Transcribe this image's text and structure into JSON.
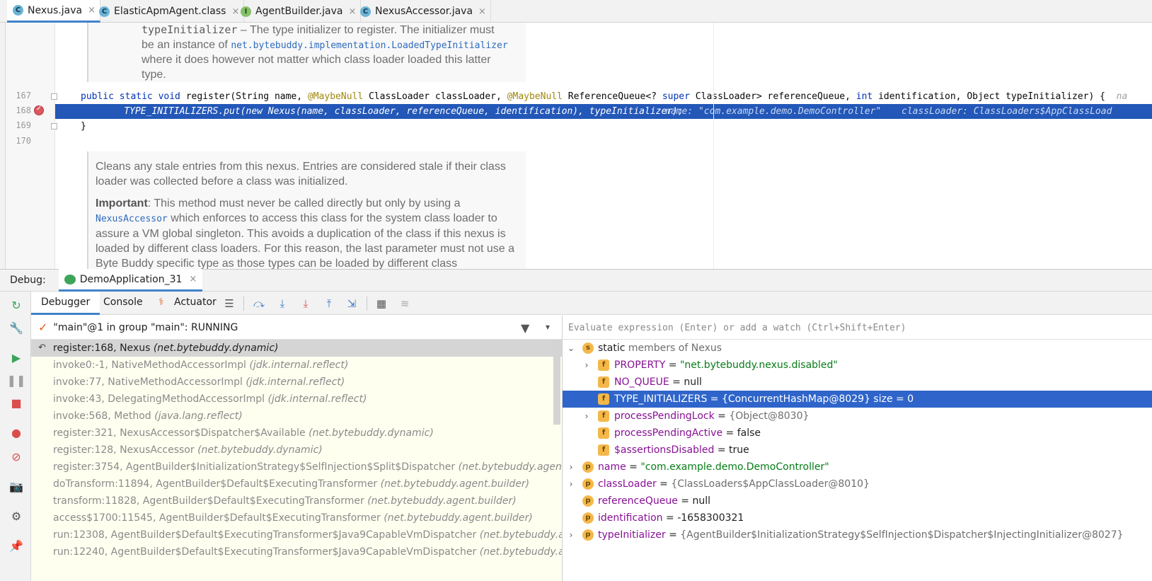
{
  "editor_tabs": [
    {
      "label": "Nexus.java",
      "icon": "class-icon",
      "active": true
    },
    {
      "label": "ElasticApmAgent.class",
      "icon": "class-icon",
      "active": false
    },
    {
      "label": "AgentBuilder.java",
      "icon": "interface-icon",
      "active": false
    },
    {
      "label": "NexusAccessor.java",
      "icon": "class-icon",
      "active": false
    }
  ],
  "tab_close": "×",
  "editor": {
    "doc_top": {
      "param_name": "typeInitializer",
      "line1_rest": " – The type initializer to register. The initializer must",
      "line2_pre": "be an instance of ",
      "line2_link": "net.bytebuddy.implementation.LoadedTypeInitializer",
      "line3": "where it does however not matter which class loader loaded this latter",
      "line4": "type."
    },
    "line_numbers": [
      "167",
      "168",
      "169",
      "170"
    ],
    "code_167": {
      "kw1": "public static void ",
      "p1": "register(String name, ",
      "ann1": "@MaybeNull ",
      "p2": "ClassLoader classLoader, ",
      "ann2": "@MaybeNull ",
      "p3": "ReferenceQueue<? ",
      "kw2": "super ",
      "p4": "ClassLoader> referenceQueue, ",
      "kw3": "int ",
      "p5": "identification, Object typeInitializer) {",
      "trail": "na"
    },
    "code_168": "    TYPE_INITIALIZERS.put(new Nexus(name, classLoader, referenceQueue, identification), typeInitializer);",
    "inline_168_a": "name: \"com.example.demo.DemoController\"",
    "inline_168_b": "classLoader: ClassLoaders$AppClassLoad",
    "code_169": "}",
    "doc_bottom": {
      "p1": "Cleans any stale entries from this nexus. Entries are considered stale if their class loader was collected before a class was initialized.",
      "p2_bold": "Important",
      "p2_a": ": This method must never be called directly but only by using a ",
      "p2_link": "NexusAccessor",
      "p2_b": " which enforces to access this class for the system class loader to assure a VM global singleton. This avoids a duplication of the class if this nexus is loaded by different class loaders. For this reason, the last parameter must not use a Byte Buddy specific type as those types can be loaded by different class"
    }
  },
  "debug": {
    "title": "Debug:",
    "run_tab": "DemoApplication_31",
    "tabs": [
      "Debugger",
      "Console",
      "Actuator"
    ],
    "thread": "\"main\"@1 in group \"main\": RUNNING",
    "watch_placeholder": "Evaluate expression (Enter) or add a watch (Ctrl+Shift+Enter)",
    "frames": [
      {
        "method": "register:168, Nexus ",
        "pkg": "(net.bytebuddy.dynamic)"
      },
      {
        "method": "invoke0:-1, NativeMethodAccessorImpl ",
        "pkg": "(jdk.internal.reflect)"
      },
      {
        "method": "invoke:77, NativeMethodAccessorImpl ",
        "pkg": "(jdk.internal.reflect)"
      },
      {
        "method": "invoke:43, DelegatingMethodAccessorImpl ",
        "pkg": "(jdk.internal.reflect)"
      },
      {
        "method": "invoke:568, Method ",
        "pkg": "(java.lang.reflect)"
      },
      {
        "method": "register:321, NexusAccessor$Dispatcher$Available ",
        "pkg": "(net.bytebuddy.dynamic)"
      },
      {
        "method": "register:128, NexusAccessor ",
        "pkg": "(net.bytebuddy.dynamic)"
      },
      {
        "method": "register:3754, AgentBuilder$InitializationStrategy$SelfInjection$Split$Dispatcher ",
        "pkg": "(net.bytebuddy.agent.builder)"
      },
      {
        "method": "doTransform:11894, AgentBuilder$Default$ExecutingTransformer ",
        "pkg": "(net.bytebuddy.agent.builder)"
      },
      {
        "method": "transform:11828, AgentBuilder$Default$ExecutingTransformer ",
        "pkg": "(net.bytebuddy.agent.builder)"
      },
      {
        "method": "access$1700:11545, AgentBuilder$Default$ExecutingTransformer ",
        "pkg": "(net.bytebuddy.agent.builder)"
      },
      {
        "method": "run:12308, AgentBuilder$Default$ExecutingTransformer$Java9CapableVmDispatcher ",
        "pkg": "(net.bytebuddy.agent.buil"
      },
      {
        "method": "run:12240, AgentBuilder$Default$ExecutingTransformer$Java9CapableVmDispatcher ",
        "pkg": "(net.bytebuddy.agent.buil"
      }
    ],
    "variables": [
      {
        "badge": "s",
        "name": "static",
        "eq": " members of Nexus",
        "value": "",
        "kind": "plain"
      },
      {
        "badge": "f",
        "name": "PROPERTY",
        "eq": " = ",
        "value": "\"net.bytebuddy.nexus.disabled\"",
        "kind": "str"
      },
      {
        "badge": "f",
        "name": "NO_QUEUE",
        "eq": " = ",
        "value": "null",
        "kind": "val"
      },
      {
        "badge": "f",
        "name": "TYPE_INITIALIZERS",
        "eq": " = ",
        "value": "{ConcurrentHashMap@8029}  size = 0",
        "kind": "muted"
      },
      {
        "badge": "f",
        "name": "processPendingLock",
        "eq": " = ",
        "value": "{Object@8030}",
        "kind": "muted"
      },
      {
        "badge": "f",
        "name": "processPendingActive",
        "eq": " = ",
        "value": "false",
        "kind": "val"
      },
      {
        "badge": "f",
        "name": "$assertionsDisabled",
        "eq": " = ",
        "value": "true",
        "kind": "val"
      },
      {
        "badge": "p",
        "name": "name",
        "eq": " = ",
        "value": "\"com.example.demo.DemoController\"",
        "kind": "str"
      },
      {
        "badge": "p",
        "name": "classLoader",
        "eq": " = ",
        "value": "{ClassLoaders$AppClassLoader@8010}",
        "kind": "muted"
      },
      {
        "badge": "p",
        "name": "referenceQueue",
        "eq": " = ",
        "value": "null",
        "kind": "val"
      },
      {
        "badge": "p",
        "name": "identification",
        "eq": " = ",
        "value": "-1658300321",
        "kind": "val"
      },
      {
        "badge": "p",
        "name": "typeInitializer",
        "eq": " = ",
        "value": "{AgentBuilder$InitializationStrategy$SelfInjection$Dispatcher$InjectingInitializer@8027}",
        "kind": "muted"
      }
    ]
  },
  "colors": {
    "accent": "#4083c9",
    "selection": "#2f65ca",
    "breakpoint": "#db5860"
  }
}
